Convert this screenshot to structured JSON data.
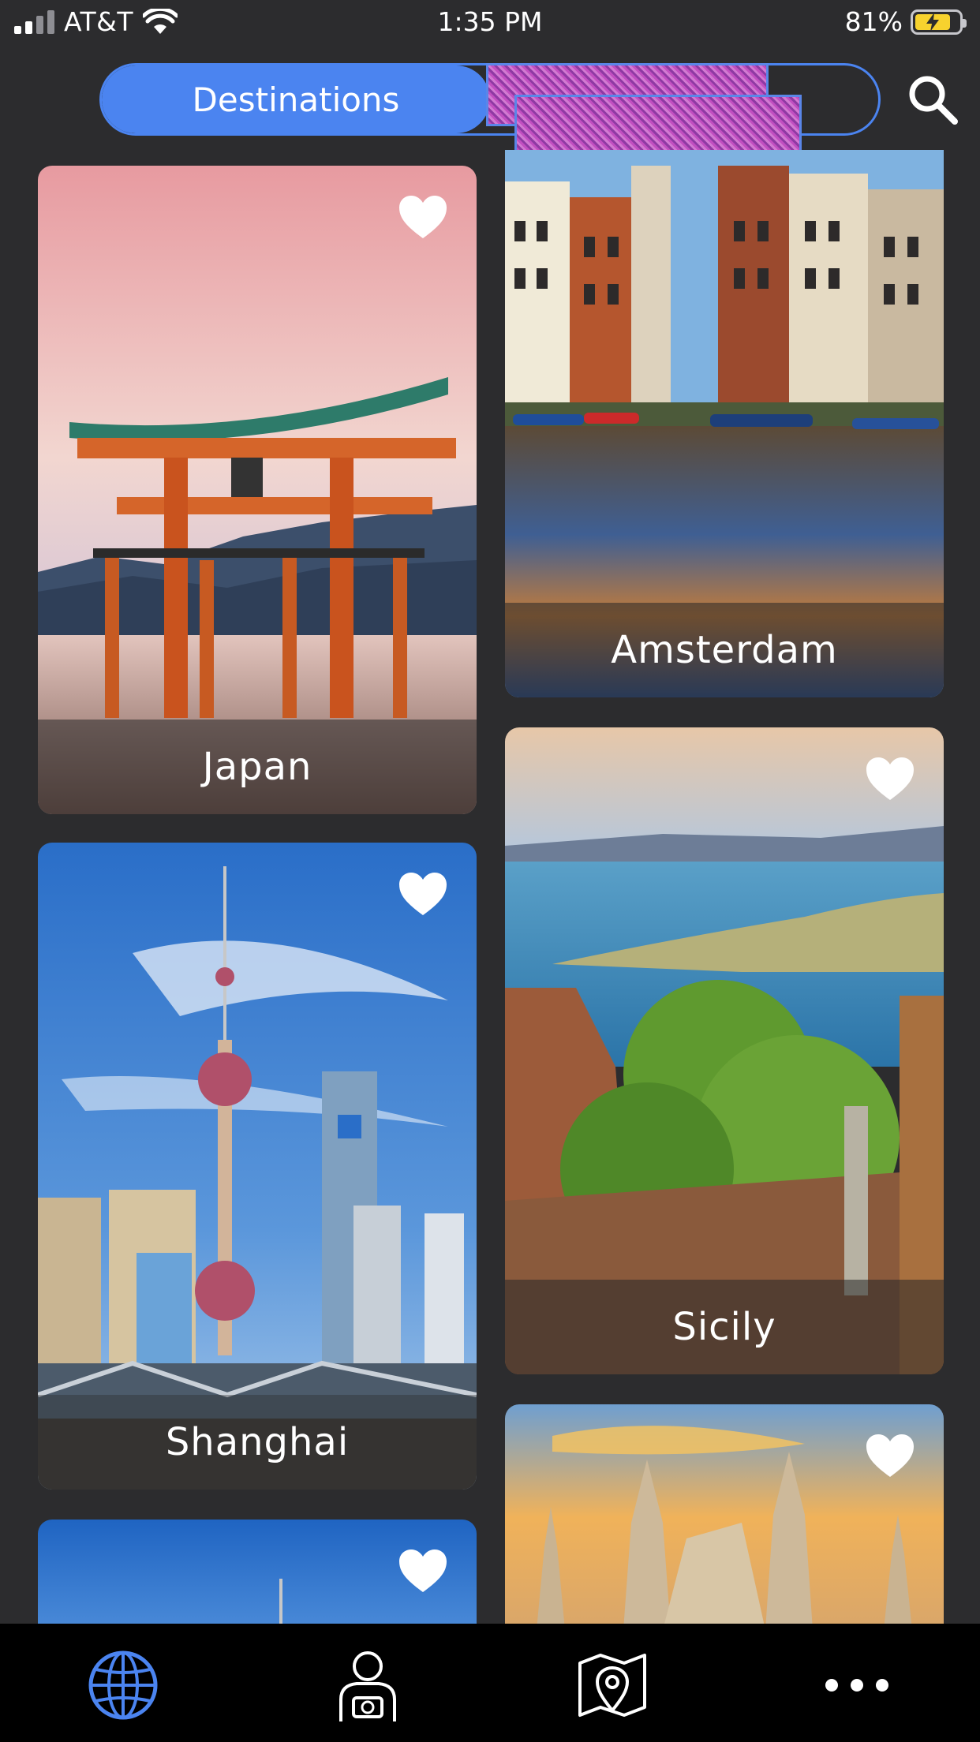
{
  "status_bar": {
    "carrier": "AT&T",
    "time": "1:35 PM",
    "battery_percent": "81%"
  },
  "segment": {
    "active_label": "Destinations",
    "inactive_label": ""
  },
  "cards": [
    {
      "label": "Japan",
      "favorite": true
    },
    {
      "label": "Amsterdam",
      "favorite": false
    },
    {
      "label": "Sicily",
      "favorite": true
    },
    {
      "label": "Shanghai",
      "favorite": true
    },
    {
      "label": "",
      "favorite": true
    },
    {
      "label": "",
      "favorite": true
    }
  ],
  "tabbar": {
    "items": [
      "globe-icon",
      "photographer-icon",
      "map-pin-icon",
      "more-icon"
    ],
    "active_index": 0
  },
  "colors": {
    "accent": "#4b84f0",
    "background": "#2c2c2e",
    "tabbar": "#000000"
  }
}
